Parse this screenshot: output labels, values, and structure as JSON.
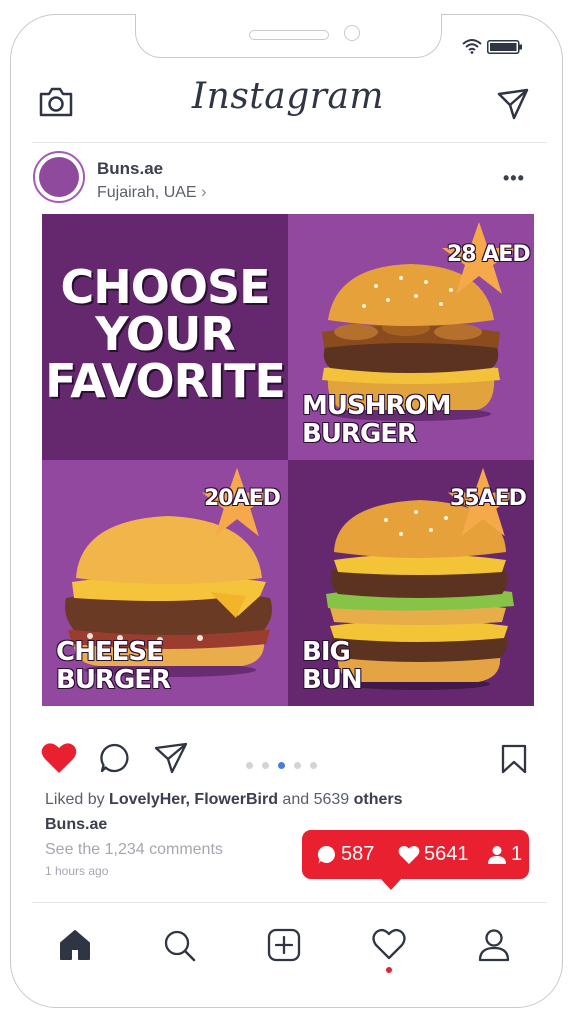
{
  "app": {
    "title": "Instagram"
  },
  "status_bar": {
    "icons": [
      "wifi-icon",
      "battery-icon"
    ]
  },
  "header": {
    "left_icon": "camera-icon",
    "right_icon": "send-icon"
  },
  "post": {
    "username": "Buns.ae",
    "location": "Fujairah, UAE",
    "location_chevron": "›",
    "more": "•••",
    "image": {
      "headline_lines": [
        "CHOOSE",
        "YOUR",
        "FAVORITE"
      ],
      "items": [
        {
          "name_lines": [
            "MUSHROM",
            "BURGER"
          ],
          "price": "28 AED"
        },
        {
          "name_lines": [
            "CHEESE",
            "BURGER"
          ],
          "price": "20AED"
        },
        {
          "name_lines": [
            "BIG",
            "BUN"
          ],
          "price": "35AED"
        }
      ],
      "colors": {
        "dark_purple": "#65286f",
        "light_purple": "#9348a0",
        "star": "#f6a94a"
      }
    },
    "carousel": {
      "count": 5,
      "active_index": 2
    },
    "liked_by": {
      "prefix": "Liked by ",
      "users": "LovelyHer, FlowerBird",
      "middle": " and 5639 ",
      "suffix": "others"
    },
    "caption_user": "Buns.ae",
    "comments_link": "See the 1,234 comments",
    "timestamp": "1 hours ago"
  },
  "notification": {
    "comments": "587",
    "likes": "5641",
    "followers": "1",
    "color": "#e8202f"
  },
  "bottom_nav": {
    "items": [
      "home-icon",
      "search-icon",
      "add-post-icon",
      "activity-icon",
      "profile-icon"
    ],
    "active_dot_color": "#e8202f"
  }
}
